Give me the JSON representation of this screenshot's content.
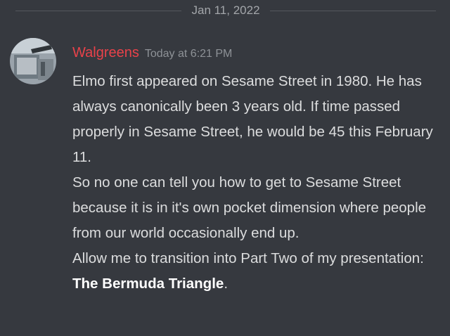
{
  "divider": {
    "date": "Jan 11, 2022"
  },
  "message": {
    "username": "Walgreens",
    "timestamp": "Today at 6:21 PM",
    "paragraphs": [
      "Elmo first appeared on Sesame Street in 1980. He has always canonically been 3 years old. If time passed properly in Sesame Street, he would be 45 this February 11.",
      "So no one can tell you how to get to Sesame Street because it is in it's own pocket dimension where people from our world occasionally end up."
    ],
    "last_paragraph_prefix": "Allow me to transition into Part Two of my presentation: ",
    "last_paragraph_bold": "The Bermuda Triangle",
    "last_paragraph_suffix": "."
  },
  "colors": {
    "background": "#36393f",
    "username": "#e9424a",
    "text": "#dcddde",
    "muted": "#8e9297"
  }
}
